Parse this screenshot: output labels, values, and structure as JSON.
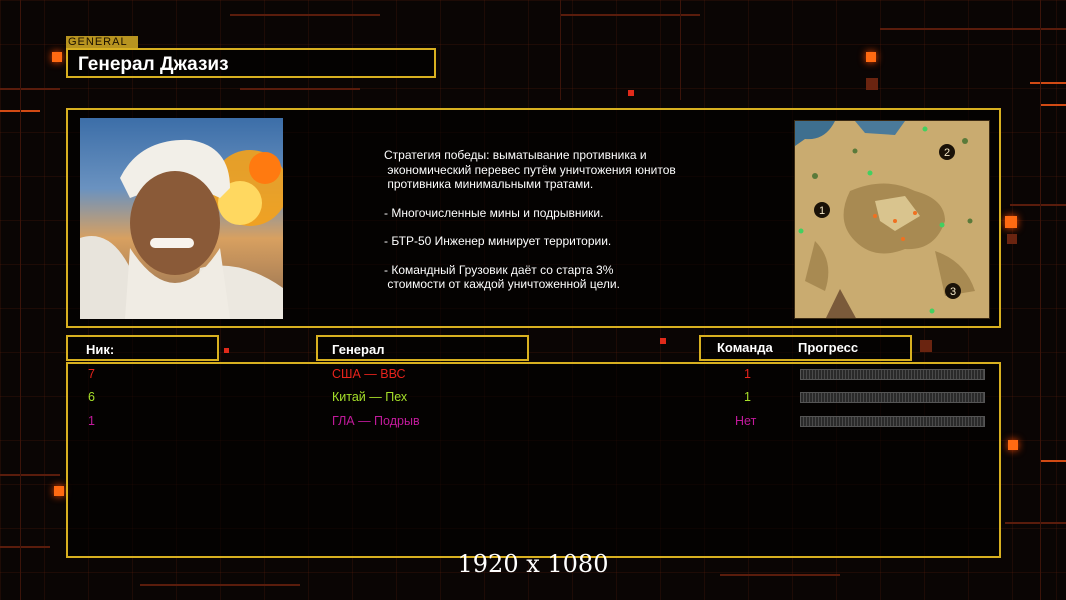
{
  "colors": {
    "frame": "#d8b020",
    "usa": "#e8231c",
    "china": "#a6e02a",
    "gla": "#c21a9c",
    "accent": "#ff6a12"
  },
  "header": {
    "tag": "GENERAL",
    "title": "Генерал Джазиз"
  },
  "info": {
    "portrait_icon": "general-portrait",
    "map_icon": "minimap",
    "description": [
      "Стратегия победы: выматывание противника и",
      " экономический перевес путём уничтожения юнитов",
      " противника минимальными тратами.",
      "",
      "- Многочисленные мины и подрывники.",
      "",
      "- БТР-50 Инженер минирует территории.",
      "",
      "- Командный Грузовик даёт со старта 3%",
      " стоимости от каждой уничтоженной цели."
    ],
    "map_markers": [
      "1",
      "2",
      "3"
    ]
  },
  "columns": {
    "nick": "Ник:",
    "general": "Генерал",
    "team": "Команда",
    "progress": "Прогресс"
  },
  "players": [
    {
      "nick": "7",
      "general": "США — ВВС",
      "team": "1",
      "color": "#e8231c"
    },
    {
      "nick": "6",
      "general": "Китай — Пех",
      "team": "1",
      "color": "#a6e02a"
    },
    {
      "nick": "1",
      "general": "ГЛА — Подрыв",
      "team": "Нет",
      "color": "#c21a9c"
    }
  ],
  "resolution": "1920 x 1080"
}
